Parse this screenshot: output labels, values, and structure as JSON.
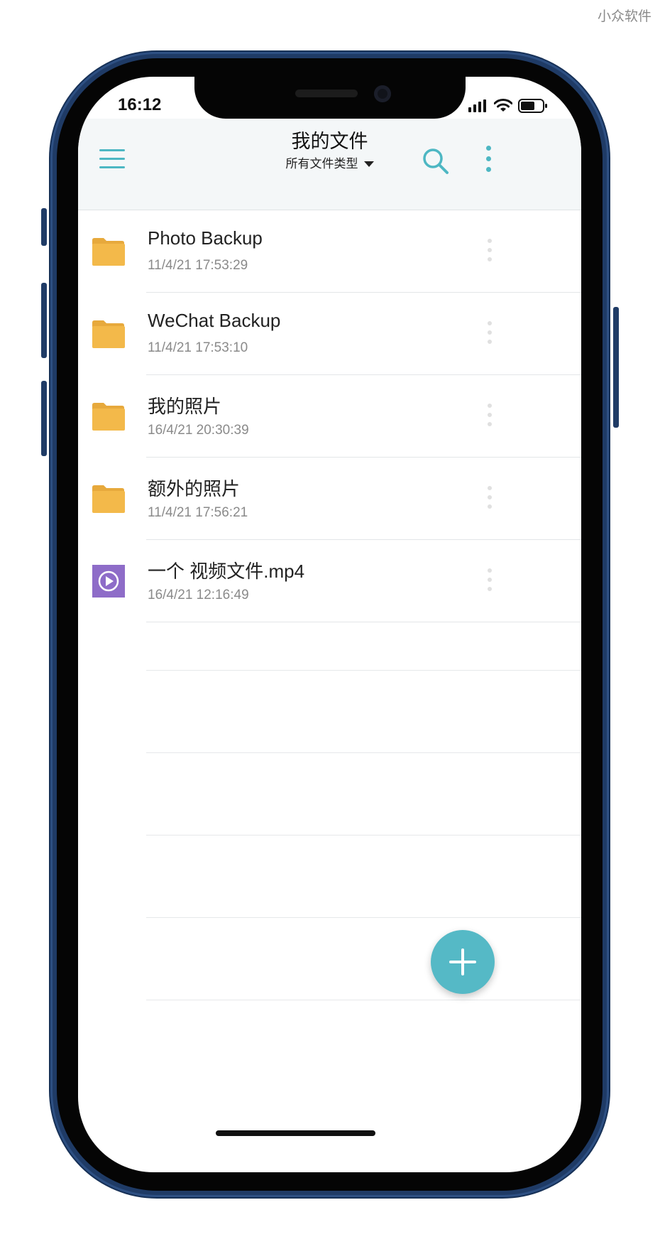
{
  "watermark": "小众软件",
  "status_bar": {
    "time": "16:12"
  },
  "header": {
    "title": "我的文件",
    "filter_label": "所有文件类型"
  },
  "files": [
    {
      "name": "Photo Backup",
      "date": "11/4/21 17:53:29",
      "type": "folder",
      "icon": "folder-icon"
    },
    {
      "name": "WeChat Backup",
      "date": "11/4/21 17:53:10",
      "type": "folder",
      "icon": "folder-icon"
    },
    {
      "name": "我的照片",
      "date": "16/4/21 20:30:39",
      "type": "folder",
      "icon": "folder-icon"
    },
    {
      "name": "额外的照片",
      "date": "11/4/21 17:56:21",
      "type": "folder",
      "icon": "folder-icon"
    },
    {
      "name": "一个 视频文件.mp4",
      "date": "16/4/21 12:16:49",
      "type": "video",
      "icon": "video-file-icon"
    }
  ],
  "colors": {
    "accent": "#4db7c3",
    "folder": "#f3b94a",
    "video": "#8e6cc8",
    "fab": "#55b9c6",
    "phone_frame": "#1f3b66"
  }
}
